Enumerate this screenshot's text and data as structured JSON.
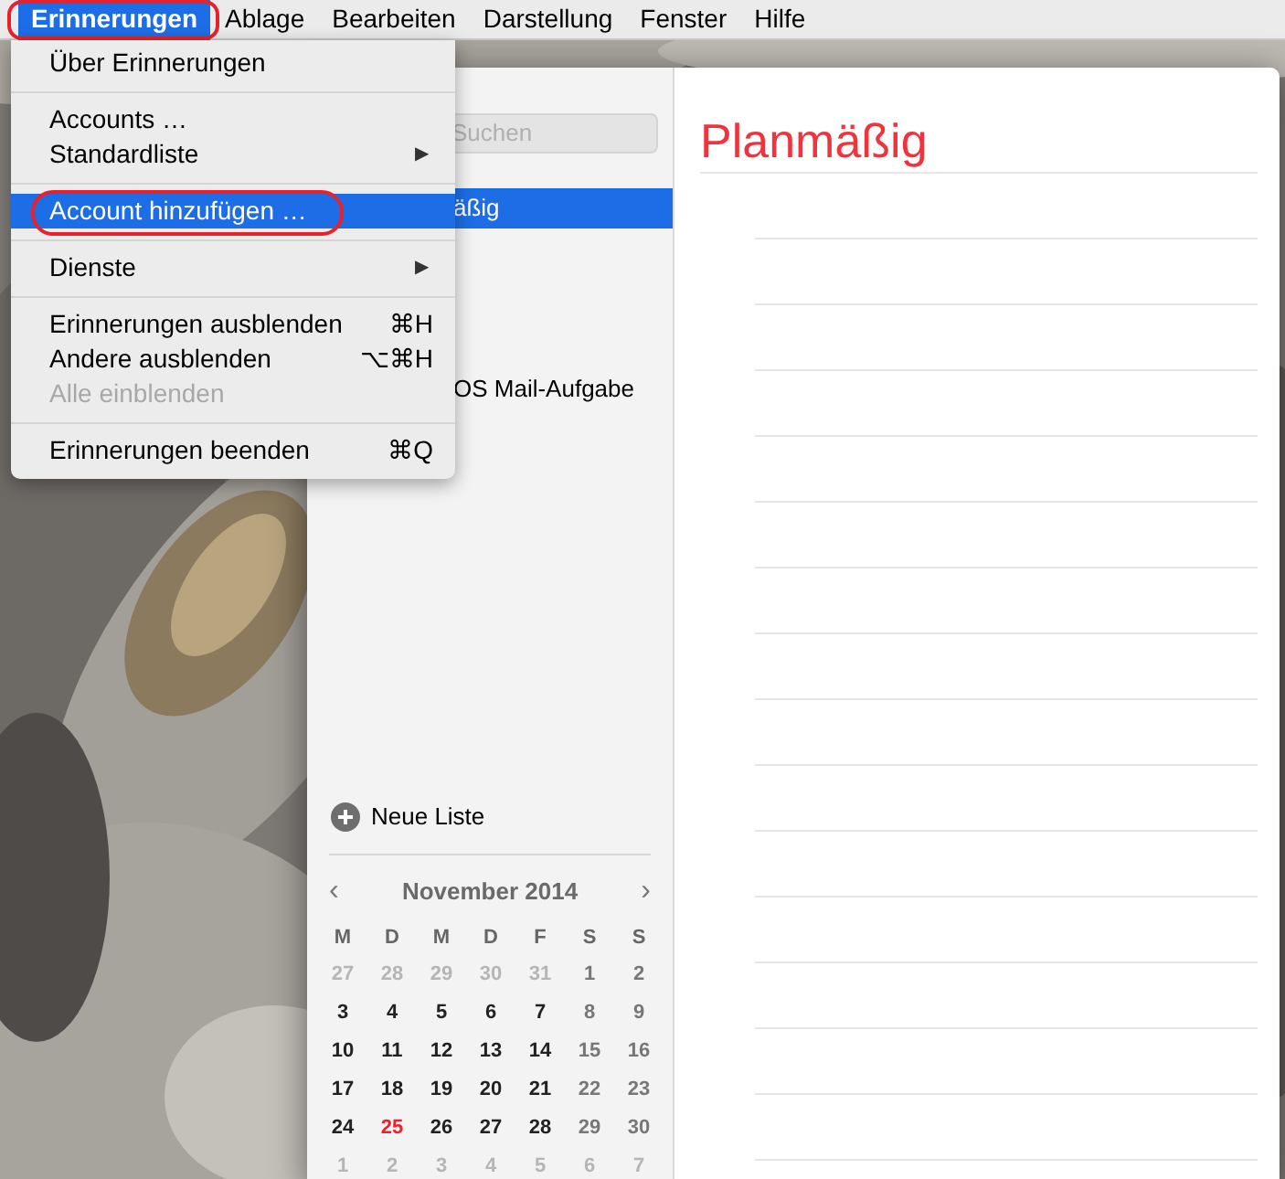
{
  "menu_bar": {
    "items": [
      {
        "label": "Erinnerungen",
        "selected": true,
        "annotated": true
      },
      {
        "label": "Ablage",
        "selected": false,
        "annotated": false
      },
      {
        "label": "Bearbeiten",
        "selected": false,
        "annotated": false
      },
      {
        "label": "Darstellung",
        "selected": false,
        "annotated": false
      },
      {
        "label": "Fenster",
        "selected": false,
        "annotated": false
      },
      {
        "label": "Hilfe",
        "selected": false,
        "annotated": false
      }
    ]
  },
  "menu": {
    "items": [
      {
        "kind": "item",
        "label": "Über Erinnerungen",
        "selected": false,
        "disabled": false,
        "annotated": false
      },
      {
        "kind": "separator"
      },
      {
        "kind": "item",
        "label": "Accounts …",
        "selected": false,
        "disabled": false,
        "annotated": false
      },
      {
        "kind": "item",
        "label": "Standardliste",
        "arrow": "▶",
        "selected": false,
        "disabled": false,
        "annotated": false
      },
      {
        "kind": "separator"
      },
      {
        "kind": "item",
        "label": "Account hinzufügen …",
        "selected": true,
        "disabled": false,
        "annotated": true
      },
      {
        "kind": "separator"
      },
      {
        "kind": "item",
        "label": "Dienste",
        "arrow": "▶",
        "selected": false,
        "disabled": false,
        "annotated": false
      },
      {
        "kind": "separator"
      },
      {
        "kind": "item",
        "label": "Erinnerungen ausblenden",
        "shortcut": "⌘H",
        "selected": false,
        "disabled": false,
        "annotated": false
      },
      {
        "kind": "item",
        "label": "Andere ausblenden",
        "shortcut": "⌥⌘H",
        "selected": false,
        "disabled": false,
        "annotated": false
      },
      {
        "kind": "item",
        "label": "Alle einblenden",
        "selected": false,
        "disabled": true,
        "annotated": false
      },
      {
        "kind": "separator"
      },
      {
        "kind": "item",
        "label": "Erinnerungen beenden",
        "shortcut": "⌘Q",
        "selected": false,
        "disabled": false,
        "annotated": false
      }
    ]
  },
  "sidebar": {
    "search": {
      "placeholder": "Suchen"
    },
    "lists": [
      {
        "label": "äßig",
        "selected": true
      },
      {
        "label": "OS Mail-Aufgabe",
        "selected": false
      }
    ],
    "new_list": "Neue Liste",
    "calendar": {
      "prev": "‹",
      "title": "November 2014",
      "next": "›",
      "weekdays": [
        "M",
        "D",
        "M",
        "D",
        "F",
        "S",
        "S"
      ],
      "days": [
        {
          "text": "27",
          "kind": "other"
        },
        {
          "text": "28",
          "kind": "other"
        },
        {
          "text": "29",
          "kind": "other"
        },
        {
          "text": "30",
          "kind": "other"
        },
        {
          "text": "31",
          "kind": "other"
        },
        {
          "text": "1",
          "kind": "weekend"
        },
        {
          "text": "2",
          "kind": "weekend"
        },
        {
          "text": "3",
          "kind": "day"
        },
        {
          "text": "4",
          "kind": "day"
        },
        {
          "text": "5",
          "kind": "day"
        },
        {
          "text": "6",
          "kind": "day"
        },
        {
          "text": "7",
          "kind": "day"
        },
        {
          "text": "8",
          "kind": "weekend"
        },
        {
          "text": "9",
          "kind": "weekend"
        },
        {
          "text": "10",
          "kind": "day"
        },
        {
          "text": "11",
          "kind": "day"
        },
        {
          "text": "12",
          "kind": "day"
        },
        {
          "text": "13",
          "kind": "day"
        },
        {
          "text": "14",
          "kind": "day"
        },
        {
          "text": "15",
          "kind": "weekend"
        },
        {
          "text": "16",
          "kind": "weekend"
        },
        {
          "text": "17",
          "kind": "day"
        },
        {
          "text": "18",
          "kind": "day"
        },
        {
          "text": "19",
          "kind": "day"
        },
        {
          "text": "20",
          "kind": "day"
        },
        {
          "text": "21",
          "kind": "day"
        },
        {
          "text": "22",
          "kind": "weekend"
        },
        {
          "text": "23",
          "kind": "weekend"
        },
        {
          "text": "24",
          "kind": "day"
        },
        {
          "text": "25",
          "kind": "today"
        },
        {
          "text": "26",
          "kind": "day"
        },
        {
          "text": "27",
          "kind": "day"
        },
        {
          "text": "28",
          "kind": "day"
        },
        {
          "text": "29",
          "kind": "weekend"
        },
        {
          "text": "30",
          "kind": "weekend"
        },
        {
          "text": "1",
          "kind": "other"
        },
        {
          "text": "2",
          "kind": "other"
        },
        {
          "text": "3",
          "kind": "other"
        },
        {
          "text": "4",
          "kind": "other"
        },
        {
          "text": "5",
          "kind": "other"
        },
        {
          "text": "6",
          "kind": "other"
        },
        {
          "text": "7",
          "kind": "other"
        }
      ]
    }
  },
  "main": {
    "title": "Planmäßig"
  }
}
